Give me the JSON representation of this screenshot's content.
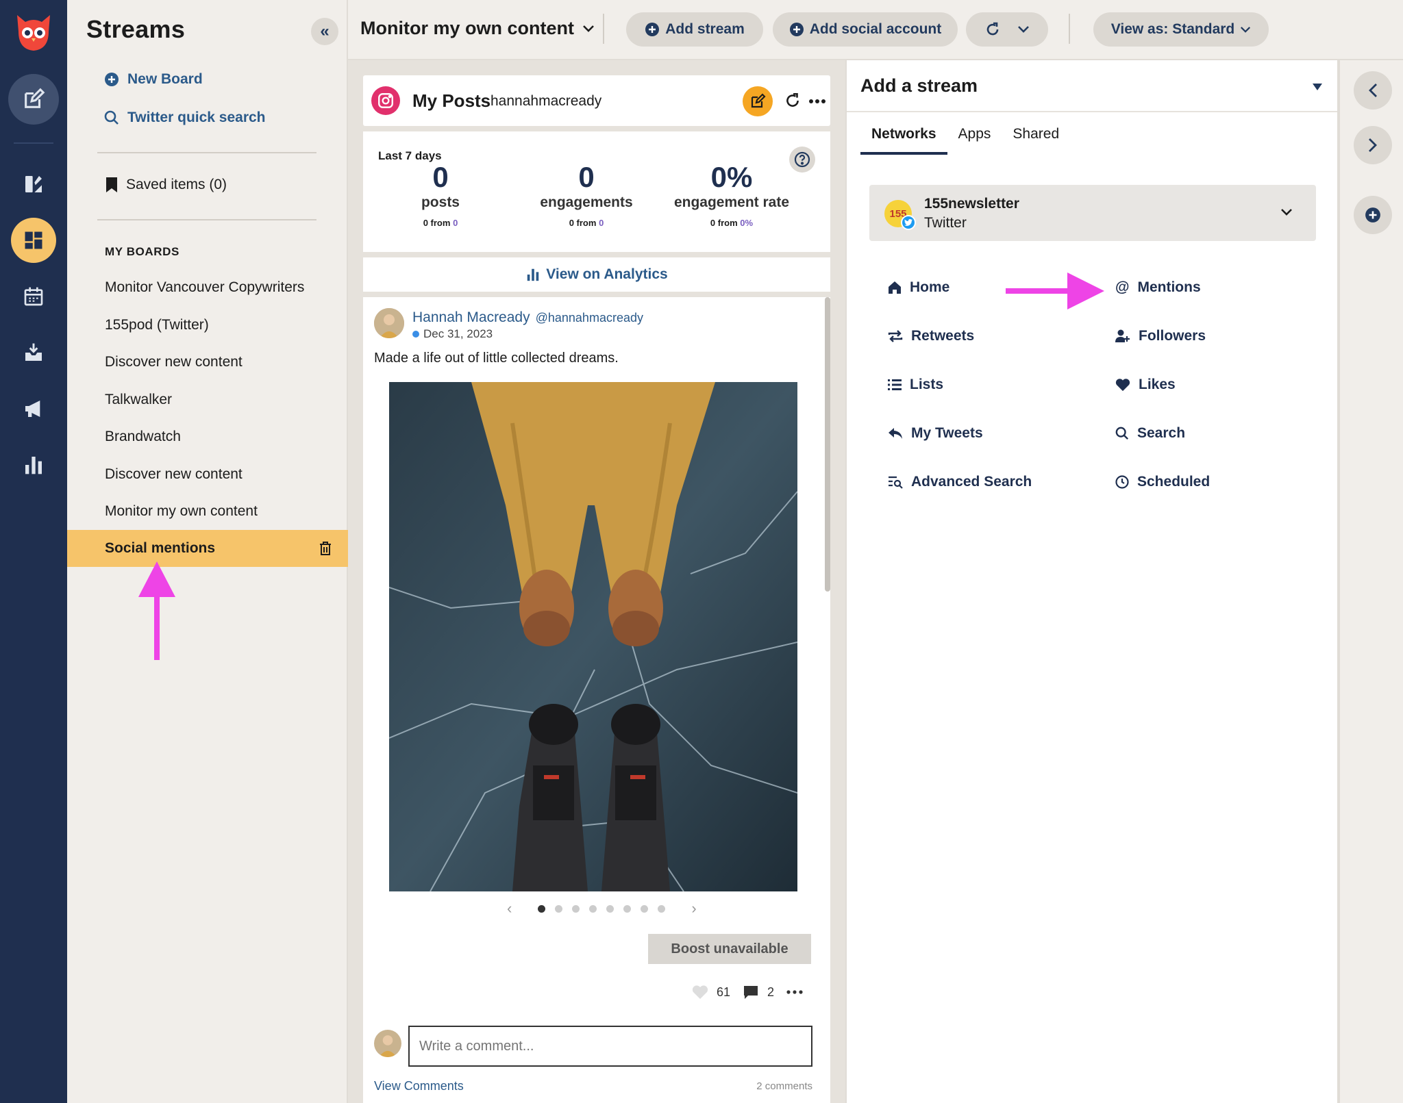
{
  "sidebar": {
    "title": "Streams",
    "new_board": "New Board",
    "twitter_search": "Twitter quick search",
    "saved_items": "Saved items (0)",
    "boards_heading": "MY BOARDS",
    "boards": [
      "Monitor Vancouver Copywriters",
      "155pod (Twitter)",
      "Discover new content",
      "Talkwalker",
      "Brandwatch",
      "Discover new content",
      "Monitor my own content",
      "Social mentions"
    ],
    "active_board_index": 7
  },
  "header": {
    "board_title": "Monitor my own content",
    "add_stream": "Add stream",
    "add_social_account": "Add social account",
    "view_as": "View as: Standard"
  },
  "stream": {
    "title": "My Posts",
    "account": "hannahmacready",
    "period": "Last 7 days",
    "stats": [
      {
        "value": "0",
        "label": "posts",
        "sub_value": "0",
        "sub_from": "from",
        "sub_prev": "0"
      },
      {
        "value": "0",
        "label": "engagements",
        "sub_value": "0",
        "sub_from": "from",
        "sub_prev": "0"
      },
      {
        "value": "0%",
        "label": "engagement rate",
        "sub_value": "0",
        "sub_from": "from",
        "sub_prev": "0%"
      }
    ],
    "view_analytics": "View on Analytics",
    "post": {
      "author": "Hannah Macready",
      "handle": "@hannahmacready",
      "date": "Dec 31, 2023",
      "text": "Made a life out of little collected dreams.",
      "boost": "Boost unavailable",
      "likes": "61",
      "comments": "2",
      "comment_placeholder": "Write a comment...",
      "view_comments": "View Comments",
      "comments_count": "2 comments",
      "carousel_dots": 8,
      "carousel_active": 0
    }
  },
  "panel": {
    "title": "Add a stream",
    "tabs": [
      "Networks",
      "Apps",
      "Shared"
    ],
    "active_tab": 0,
    "account_name": "155newsletter",
    "account_network": "Twitter",
    "account_avatar_text": "155",
    "left_items": [
      "Home",
      "Retweets",
      "Lists",
      "My Tweets",
      "Advanced Search"
    ],
    "right_items": [
      "Mentions",
      "Followers",
      "Likes",
      "Search",
      "Scheduled"
    ]
  },
  "colors": {
    "rail": "#1f2f4f",
    "accent": "#f6c46a",
    "link": "#2b5a8a",
    "arrow": "#ee44e6",
    "brand_red": "#f0473a"
  }
}
